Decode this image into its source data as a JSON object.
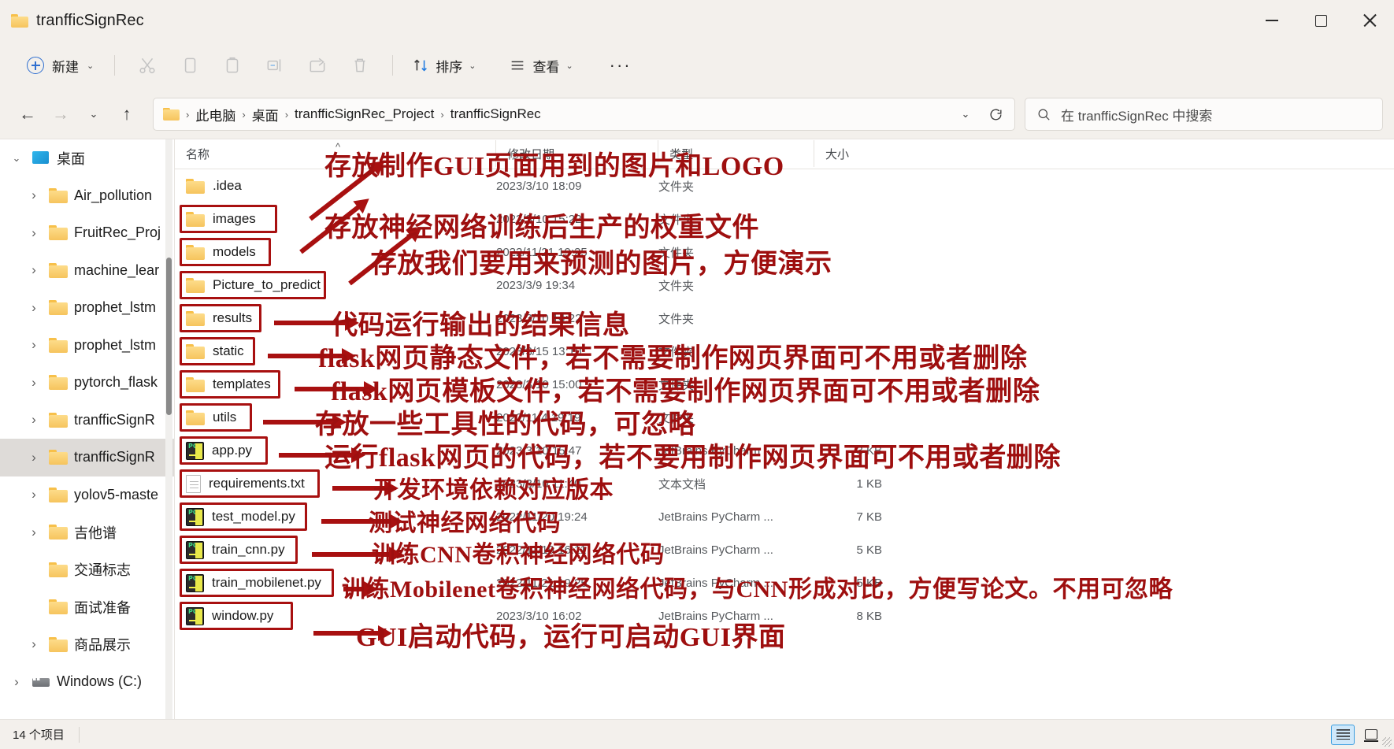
{
  "window": {
    "title": "tranfficSignRec",
    "minimize_label": "最小化",
    "maximize_label": "最大化",
    "close_label": "关闭"
  },
  "toolbar": {
    "new_label": "新建",
    "sort_label": "排序",
    "view_label": "查看",
    "more_label": "···",
    "cut_label": "剪切",
    "copy_label": "复制",
    "paste_label": "粘贴",
    "rename_label": "重命名",
    "share_label": "共享",
    "delete_label": "删除"
  },
  "addressbar": {
    "back_label": "后退",
    "forward_label": "前进",
    "recent_label": "最近浏览的位置",
    "up_label": "向上",
    "crumbs": [
      "此电脑",
      "桌面",
      "tranfficSignRec_Project",
      "tranfficSignRec"
    ],
    "separator": "›",
    "dropdown_label": "历史记录",
    "refresh_label": "刷新",
    "search_placeholder": "在 tranfficSignRec 中搜索"
  },
  "sidebar": {
    "items": [
      {
        "label": "桌面",
        "icon": "desktop-icon",
        "expandable": true,
        "expanded": true,
        "indent": 0,
        "selected": false
      },
      {
        "label": "Air_pollution",
        "icon": "folder-icon",
        "expandable": true,
        "expanded": false,
        "indent": 1,
        "selected": false
      },
      {
        "label": "FruitRec_Proj",
        "icon": "folder-icon",
        "expandable": true,
        "expanded": false,
        "indent": 1,
        "selected": false
      },
      {
        "label": "machine_lear",
        "icon": "folder-icon",
        "expandable": true,
        "expanded": false,
        "indent": 1,
        "selected": false
      },
      {
        "label": "prophet_lstm",
        "icon": "folder-icon",
        "expandable": true,
        "expanded": false,
        "indent": 1,
        "selected": false
      },
      {
        "label": "prophet_lstm",
        "icon": "folder-icon",
        "expandable": true,
        "expanded": false,
        "indent": 1,
        "selected": false
      },
      {
        "label": "pytorch_flask",
        "icon": "folder-icon",
        "expandable": true,
        "expanded": false,
        "indent": 1,
        "selected": false
      },
      {
        "label": "tranfficSignR",
        "icon": "folder-icon",
        "expandable": true,
        "expanded": false,
        "indent": 1,
        "selected": false
      },
      {
        "label": "tranfficSignR",
        "icon": "folder-icon",
        "expandable": true,
        "expanded": false,
        "indent": 1,
        "selected": true
      },
      {
        "label": "yolov5-maste",
        "icon": "folder-icon",
        "expandable": true,
        "expanded": false,
        "indent": 1,
        "selected": false
      },
      {
        "label": "吉他谱",
        "icon": "folder-icon",
        "expandable": true,
        "expanded": false,
        "indent": 1,
        "selected": false
      },
      {
        "label": "交通标志",
        "icon": "folder-icon",
        "expandable": false,
        "expanded": false,
        "indent": 1,
        "selected": false
      },
      {
        "label": "面试准备",
        "icon": "folder-icon",
        "expandable": false,
        "expanded": false,
        "indent": 1,
        "selected": false
      },
      {
        "label": "商品展示",
        "icon": "folder-icon",
        "expandable": true,
        "expanded": false,
        "indent": 1,
        "selected": false
      },
      {
        "label": "Windows (C:)",
        "icon": "drive-icon",
        "expandable": true,
        "expanded": false,
        "indent": 0,
        "selected": false
      }
    ]
  },
  "filelist": {
    "columns": [
      "名称",
      "修改日期",
      "类型",
      "大小"
    ],
    "sort_indicator": "^",
    "rows": [
      {
        "name": ".idea",
        "icon": "folder-icon",
        "date": "2023/3/10 18:09",
        "type": "文件夹",
        "size": "",
        "highlight": false
      },
      {
        "name": "images",
        "icon": "folder-icon",
        "date": "2023/3/10 15:22",
        "type": "文件夹",
        "size": "",
        "highlight": true
      },
      {
        "name": "models",
        "icon": "folder-icon",
        "date": "2022/11/21 19:25",
        "type": "文件夹",
        "size": "",
        "highlight": true
      },
      {
        "name": "Picture_to_predict",
        "icon": "folder-icon",
        "date": "2023/3/9 19:34",
        "type": "文件夹",
        "size": "",
        "highlight": true
      },
      {
        "name": "results",
        "icon": "folder-icon",
        "date": "2023/3/10 14:22",
        "type": "文件夹",
        "size": "",
        "highlight": true
      },
      {
        "name": "static",
        "icon": "folder-icon",
        "date": "2023/3/15 13:10",
        "type": "文件夹",
        "size": "",
        "highlight": true
      },
      {
        "name": "templates",
        "icon": "folder-icon",
        "date": "2023/3/10 15:00",
        "type": "文件夹",
        "size": "",
        "highlight": true
      },
      {
        "name": "utils",
        "icon": "folder-icon",
        "date": "2022/11/4 19:19",
        "type": "文件夹",
        "size": "",
        "highlight": true
      },
      {
        "name": "app.py",
        "icon": "pycharm-icon",
        "date": "2023/3/10 15:47",
        "type": "JetBrains PyCharm ...",
        "size": "3 KB",
        "highlight": true
      },
      {
        "name": "requirements.txt",
        "icon": "textfile-icon",
        "date": "2023/3/10 11:40",
        "type": "文本文档",
        "size": "1 KB",
        "highlight": true
      },
      {
        "name": "test_model.py",
        "icon": "pycharm-icon",
        "date": "2022/11/20 19:24",
        "type": "JetBrains PyCharm ...",
        "size": "7 KB",
        "highlight": true
      },
      {
        "name": "train_cnn.py",
        "icon": "pycharm-icon",
        "date": "2022/11/19 16:11",
        "type": "JetBrains PyCharm ...",
        "size": "5 KB",
        "highlight": true
      },
      {
        "name": "train_mobilenet.py",
        "icon": "pycharm-icon",
        "date": "2022/11/21 19:25",
        "type": "JetBrains PyCharm ...",
        "size": "5 KB",
        "highlight": true
      },
      {
        "name": "window.py",
        "icon": "pycharm-icon",
        "date": "2023/3/10 16:02",
        "type": "JetBrains PyCharm ...",
        "size": "8 KB",
        "highlight": true
      }
    ]
  },
  "annotations": [
    {
      "text": "存放制作GUI页面用到的图片和LOGO",
      "target": "images"
    },
    {
      "text": "存放神经网络训练后生产的权重文件",
      "target": "models"
    },
    {
      "text": "存放我们要用来预测的图片，方便演示",
      "target": "Picture_to_predict"
    },
    {
      "text": "代码运行输出的结果信息",
      "target": "results"
    },
    {
      "text": "flask网页静态文件，若不需要制作网页界面可不用或者删除",
      "target": "static"
    },
    {
      "text": "flask网页模板文件，若不需要制作网页界面可不用或者删除",
      "target": "templates"
    },
    {
      "text": "存放一些工具性的代码，可忽略",
      "target": "utils"
    },
    {
      "text": "运行flask网页的代码，若不要用制作网页界面可不用或者删除",
      "target": "app.py"
    },
    {
      "text": "开发环境依赖对应版本",
      "target": "requirements.txt"
    },
    {
      "text": "测试神经网络代码",
      "target": "test_model.py"
    },
    {
      "text": "训练CNN卷积神经网络代码",
      "target": "train_cnn.py"
    },
    {
      "text": "训练Mobilenet卷积神经网络代码，与CNN形成对比，方便写论文。不用可忽略",
      "target": "train_mobilenet.py"
    },
    {
      "text": "GUI启动代码，运行可启动GUI界面",
      "target": "window.py"
    }
  ],
  "statusbar": {
    "item_count": "14 个项目",
    "details_view_label": "详细信息",
    "tiles_view_label": "大图标"
  },
  "colors": {
    "annotation_red": "#9e0f0f",
    "box_red": "#a81010",
    "accent_blue": "#2f6fd0",
    "chrome_bg": "#f3f0ec",
    "selected_nav": "#dedbd8"
  }
}
